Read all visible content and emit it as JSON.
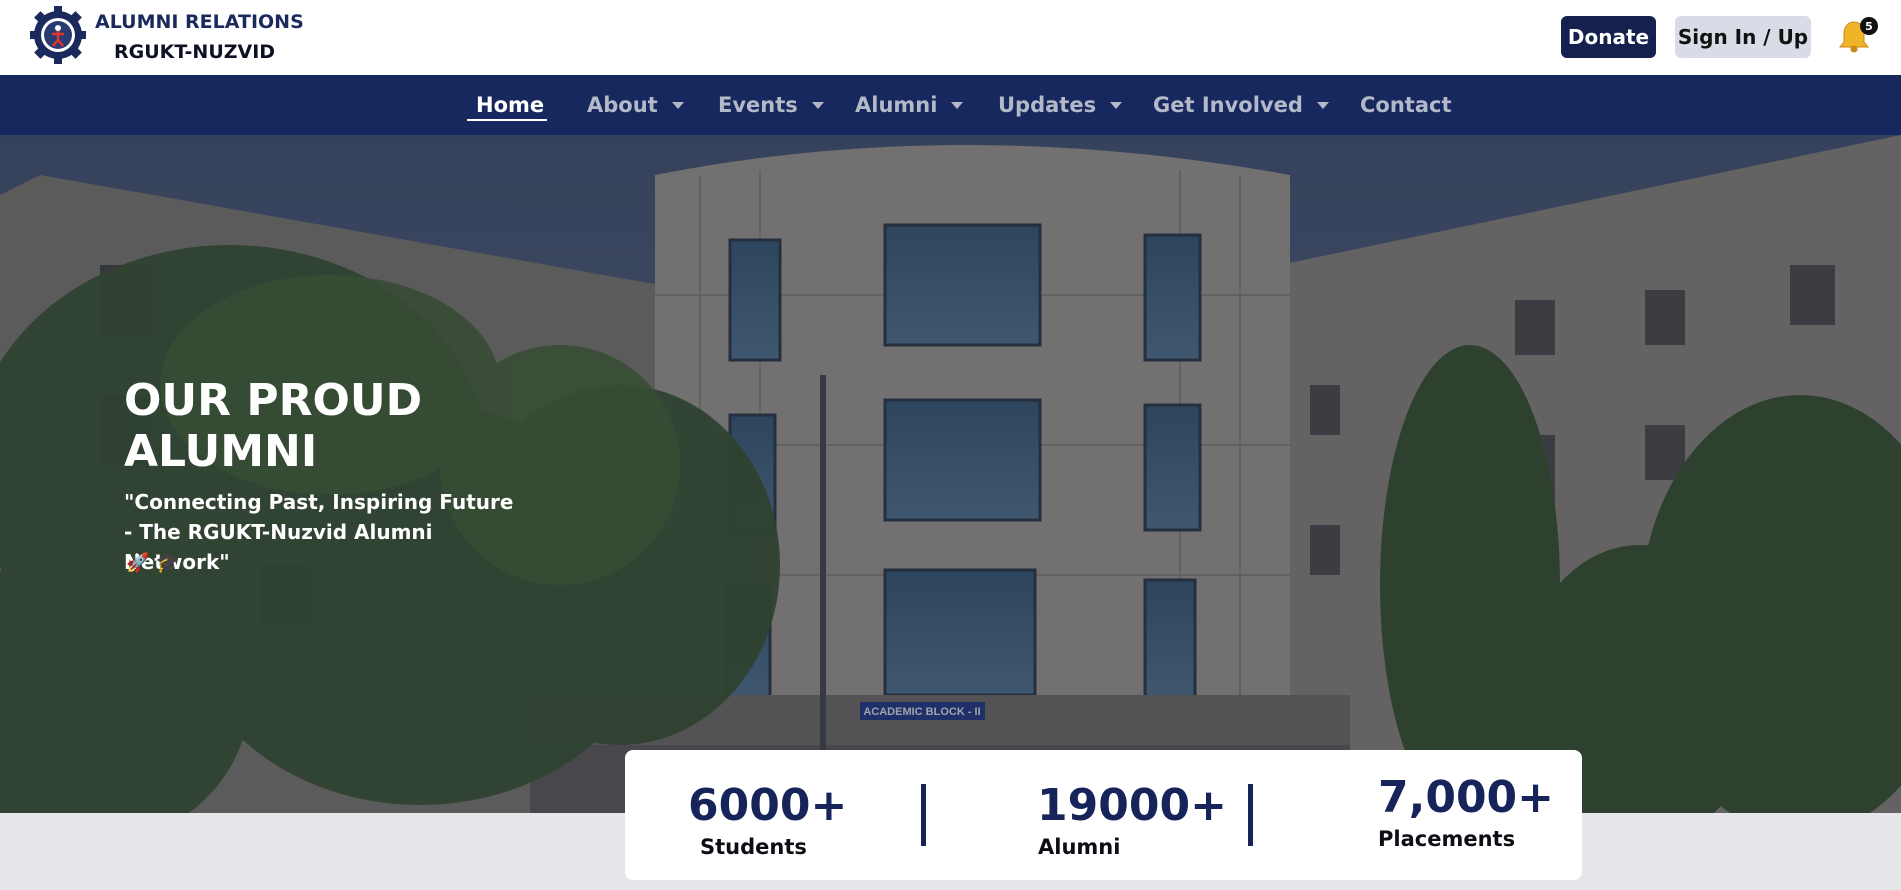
{
  "header": {
    "brand_title": "ALUMNI RELATIONS",
    "brand_subtitle": "RGUKT-NUZVID",
    "donate_label": "Donate",
    "signin_label": "Sign In / Up",
    "notification_count": "5"
  },
  "nav": {
    "items": [
      {
        "label": "Home",
        "active": true,
        "dropdown": false
      },
      {
        "label": "About",
        "dropdown": true
      },
      {
        "label": "Events",
        "dropdown": true
      },
      {
        "label": "Alumni",
        "dropdown": true
      },
      {
        "label": "Updates",
        "dropdown": true
      },
      {
        "label": "Get Involved",
        "dropdown": true
      },
      {
        "label": "Contact",
        "dropdown": false
      }
    ]
  },
  "hero": {
    "title": "OUR PROUD ALUMNI",
    "quote": "\"Connecting Past, Inspiring Future - The RGUKT-Nuzvid Alumni Network\"",
    "emoji": "🚀 🎓",
    "building_sign": "ACADEMIC BLOCK - II"
  },
  "stats": [
    {
      "value": "6000+",
      "label": "Students"
    },
    {
      "value": "19000+",
      "label": "Alumni"
    },
    {
      "value": "7,000+",
      "label": "Placements"
    }
  ],
  "colors": {
    "navy": "#17285e",
    "donate_bg": "#14214f",
    "signin_bg": "#d8dce6",
    "page_bg": "#e6e7ea"
  }
}
